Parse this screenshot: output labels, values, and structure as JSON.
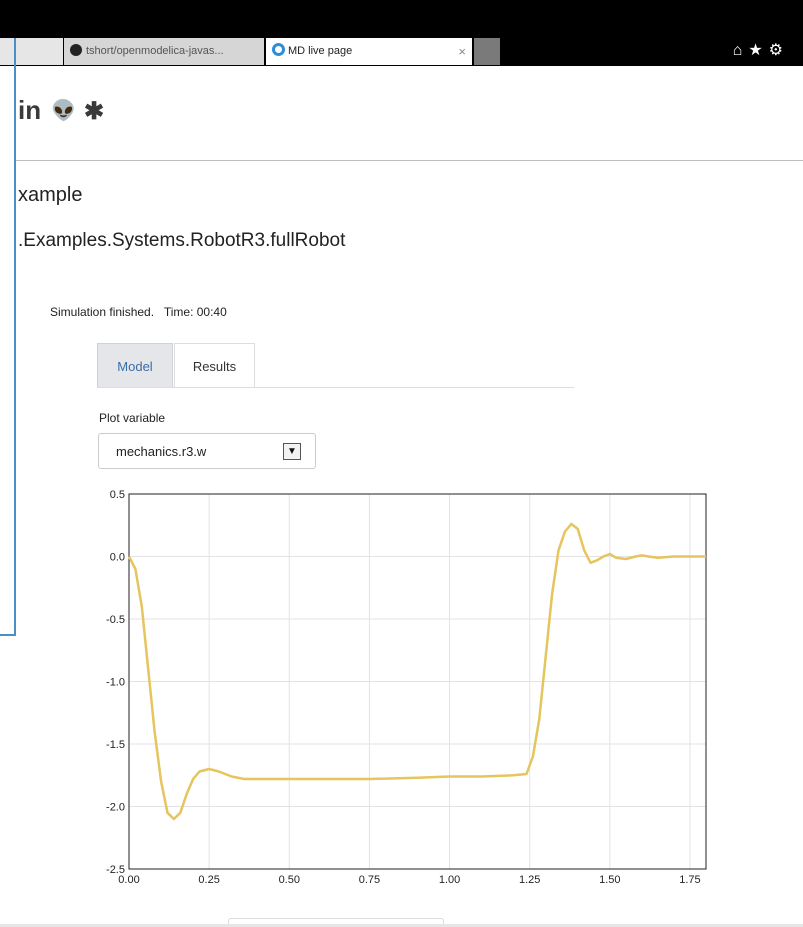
{
  "browser": {
    "tabs": [
      {
        "label": "tshort/openmodelica-javas...",
        "active": false
      },
      {
        "label": "MD live page",
        "active": true
      }
    ],
    "close_glyph": "×",
    "toolbar_icons": [
      "home-icon",
      "star-icon",
      "gear-icon"
    ]
  },
  "social": {
    "linkedin": "in"
  },
  "page": {
    "heading": "xample",
    "model_path": ".Examples.Systems.RobotR3.fullRobot",
    "status": "Simulation finished.   Time: 00:40"
  },
  "tabs": [
    {
      "label": "Model",
      "selected": false
    },
    {
      "label": "Results",
      "selected": true
    }
  ],
  "plot": {
    "label": "Plot variable",
    "selected_variable": "mechanics.r3.w"
  },
  "chart_data": {
    "type": "line",
    "title": "",
    "xlabel": "",
    "ylabel": "",
    "xlim": [
      0.0,
      1.8
    ],
    "ylim": [
      -2.5,
      0.5
    ],
    "xticks": [
      "0.00",
      "0.25",
      "0.50",
      "0.75",
      "1.00",
      "1.25",
      "1.50",
      "1.75"
    ],
    "yticks": [
      "0.5",
      "0.0",
      "-0.5",
      "-1.0",
      "-1.5",
      "-2.0",
      "-2.5"
    ],
    "grid": true,
    "color": "#e6c45e",
    "series": [
      {
        "x": [
          0.0,
          0.02,
          0.04,
          0.06,
          0.08,
          0.1,
          0.12,
          0.14,
          0.16,
          0.18,
          0.2,
          0.22,
          0.25,
          0.28,
          0.32,
          0.36,
          0.4,
          0.5,
          0.6,
          0.75,
          0.9,
          1.0,
          1.1,
          1.2,
          1.24,
          1.26,
          1.28,
          1.3,
          1.32,
          1.34,
          1.36,
          1.38,
          1.4,
          1.42,
          1.44,
          1.46,
          1.48,
          1.5,
          1.52,
          1.55,
          1.58,
          1.6,
          1.62,
          1.65,
          1.7,
          1.75,
          1.8
        ],
        "y": [
          0.0,
          -0.1,
          -0.4,
          -0.9,
          -1.4,
          -1.8,
          -2.05,
          -2.1,
          -2.05,
          -1.9,
          -1.78,
          -1.72,
          -1.7,
          -1.72,
          -1.76,
          -1.78,
          -1.78,
          -1.78,
          -1.78,
          -1.78,
          -1.77,
          -1.76,
          -1.76,
          -1.75,
          -1.74,
          -1.6,
          -1.3,
          -0.8,
          -0.3,
          0.05,
          0.2,
          0.26,
          0.22,
          0.05,
          -0.05,
          -0.03,
          0.0,
          0.02,
          -0.01,
          -0.02,
          0.0,
          0.01,
          0.0,
          -0.01,
          0.0,
          0.0,
          0.0
        ]
      }
    ]
  }
}
